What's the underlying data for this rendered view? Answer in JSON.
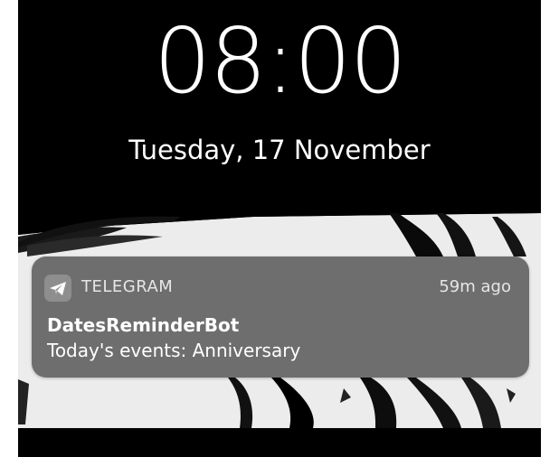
{
  "lockscreen": {
    "time": "08:00",
    "date": "Tuesday, 17 November"
  },
  "notification": {
    "app_icon": "telegram-paper-plane-icon",
    "app_name": "TELEGRAM",
    "time_ago": "59m ago",
    "sender": "DatesReminderBot",
    "message": "Today's events: Anniversary"
  },
  "colors": {
    "background": "#000000",
    "wallpaper_light": "#ececec",
    "notification_bg": "#606060",
    "text": "#ffffff"
  }
}
